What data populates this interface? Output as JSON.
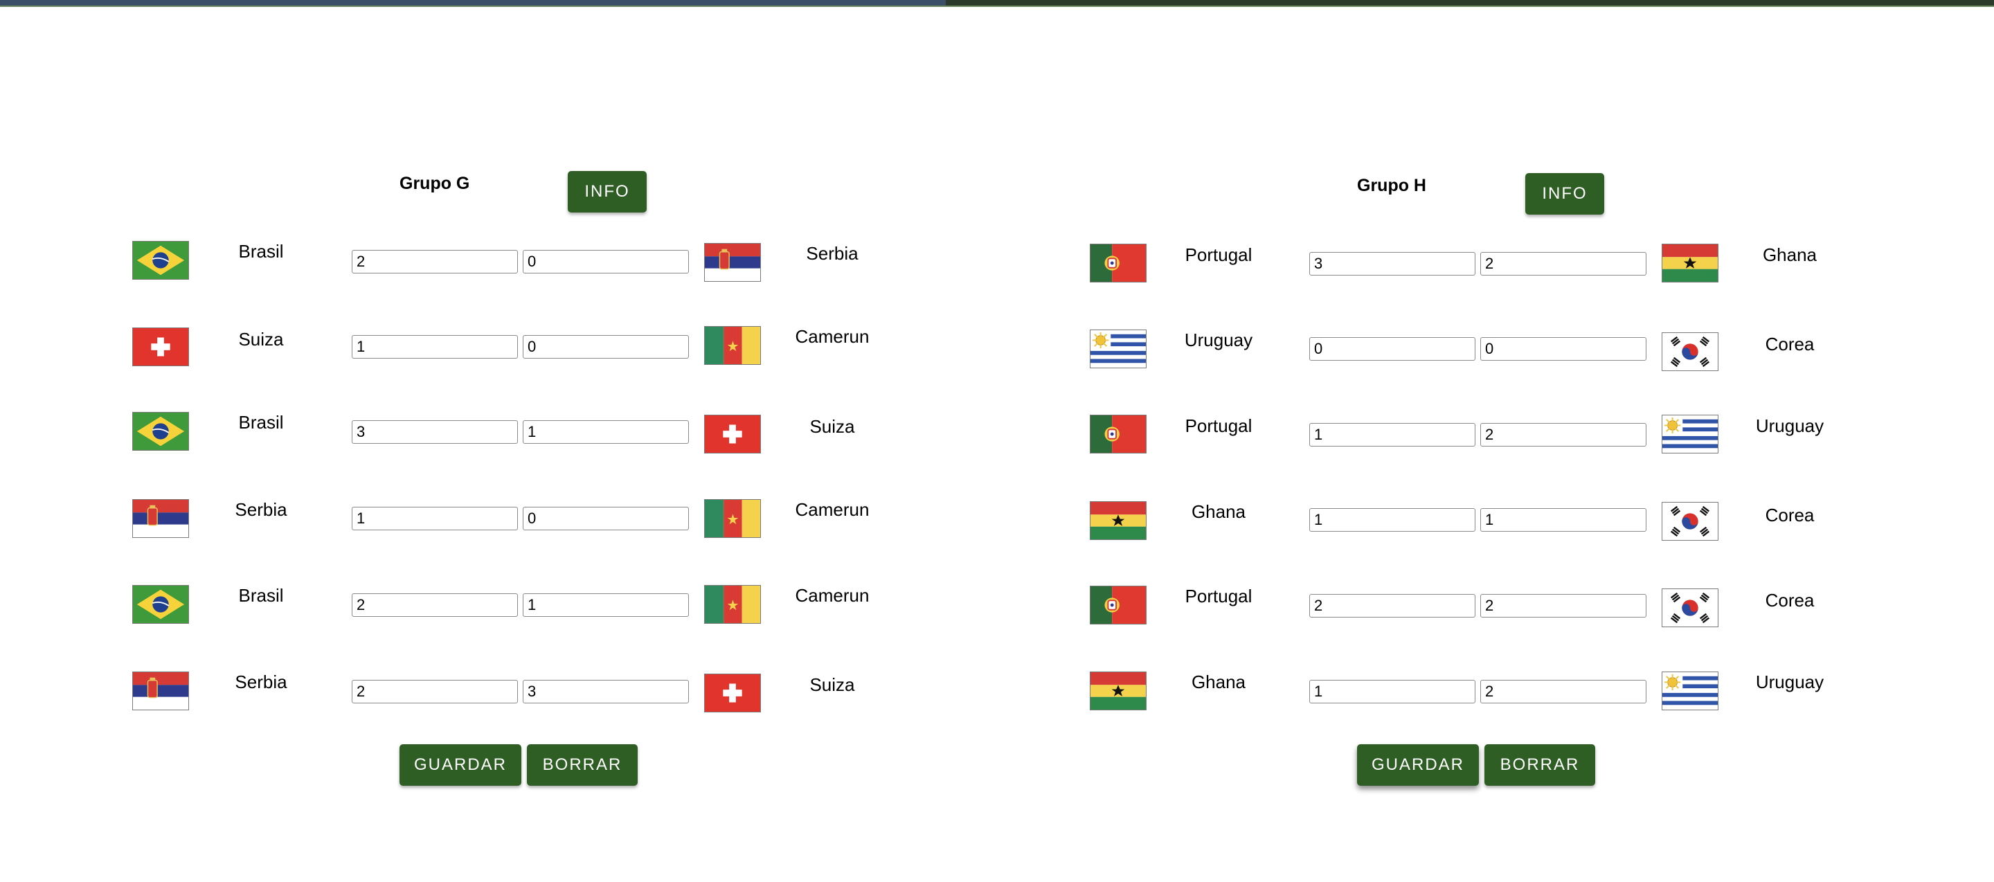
{
  "groups": [
    {
      "title": "Grupo G",
      "info_label": "INFO",
      "save_label": "GUARDAR",
      "clear_label": "BORRAR",
      "matches": [
        {
          "home": "Brasil",
          "home_flag": "brazil-flag-icon",
          "home_score": "2",
          "away_score": "0",
          "away": "Serbia",
          "away_flag": "serbia-flag-icon"
        },
        {
          "home": "Suiza",
          "home_flag": "switzerland-flag-icon",
          "home_score": "1",
          "away_score": "0",
          "away": "Camerun",
          "away_flag": "cameroon-flag-icon"
        },
        {
          "home": "Brasil",
          "home_flag": "brazil-flag-icon",
          "home_score": "3",
          "away_score": "1",
          "away": "Suiza",
          "away_flag": "switzerland-flag-icon"
        },
        {
          "home": "Serbia",
          "home_flag": "serbia-flag-icon",
          "home_score": "1",
          "away_score": "0",
          "away": "Camerun",
          "away_flag": "cameroon-flag-icon"
        },
        {
          "home": "Brasil",
          "home_flag": "brazil-flag-icon",
          "home_score": "2",
          "away_score": "1",
          "away": "Camerun",
          "away_flag": "cameroon-flag-icon"
        },
        {
          "home": "Serbia",
          "home_flag": "serbia-flag-icon",
          "home_score": "2",
          "away_score": "3",
          "away": "Suiza",
          "away_flag": "switzerland-flag-icon"
        }
      ]
    },
    {
      "title": "Grupo H",
      "info_label": "INFO",
      "save_label": "GUARDAR",
      "clear_label": "BORRAR",
      "matches": [
        {
          "home": "Portugal",
          "home_flag": "portugal-flag-icon",
          "home_score": "3",
          "away_score": "2",
          "away": "Ghana",
          "away_flag": "ghana-flag-icon"
        },
        {
          "home": "Uruguay",
          "home_flag": "uruguay-flag-icon",
          "home_score": "0",
          "away_score": "0",
          "away": "Corea",
          "away_flag": "korea-flag-icon"
        },
        {
          "home": "Portugal",
          "home_flag": "portugal-flag-icon",
          "home_score": "1",
          "away_score": "2",
          "away": "Uruguay",
          "away_flag": "uruguay-flag-icon"
        },
        {
          "home": "Ghana",
          "home_flag": "ghana-flag-icon",
          "home_score": "1",
          "away_score": "1",
          "away": "Corea",
          "away_flag": "korea-flag-icon"
        },
        {
          "home": "Portugal",
          "home_flag": "portugal-flag-icon",
          "home_score": "2",
          "away_score": "2",
          "away": "Corea",
          "away_flag": "korea-flag-icon"
        },
        {
          "home": "Ghana",
          "home_flag": "ghana-flag-icon",
          "home_score": "1",
          "away_score": "2",
          "away": "Uruguay",
          "away_flag": "uruguay-flag-icon"
        }
      ]
    }
  ],
  "colors": {
    "button_bg": "#2e5e24",
    "button_text": "#ffffff"
  }
}
